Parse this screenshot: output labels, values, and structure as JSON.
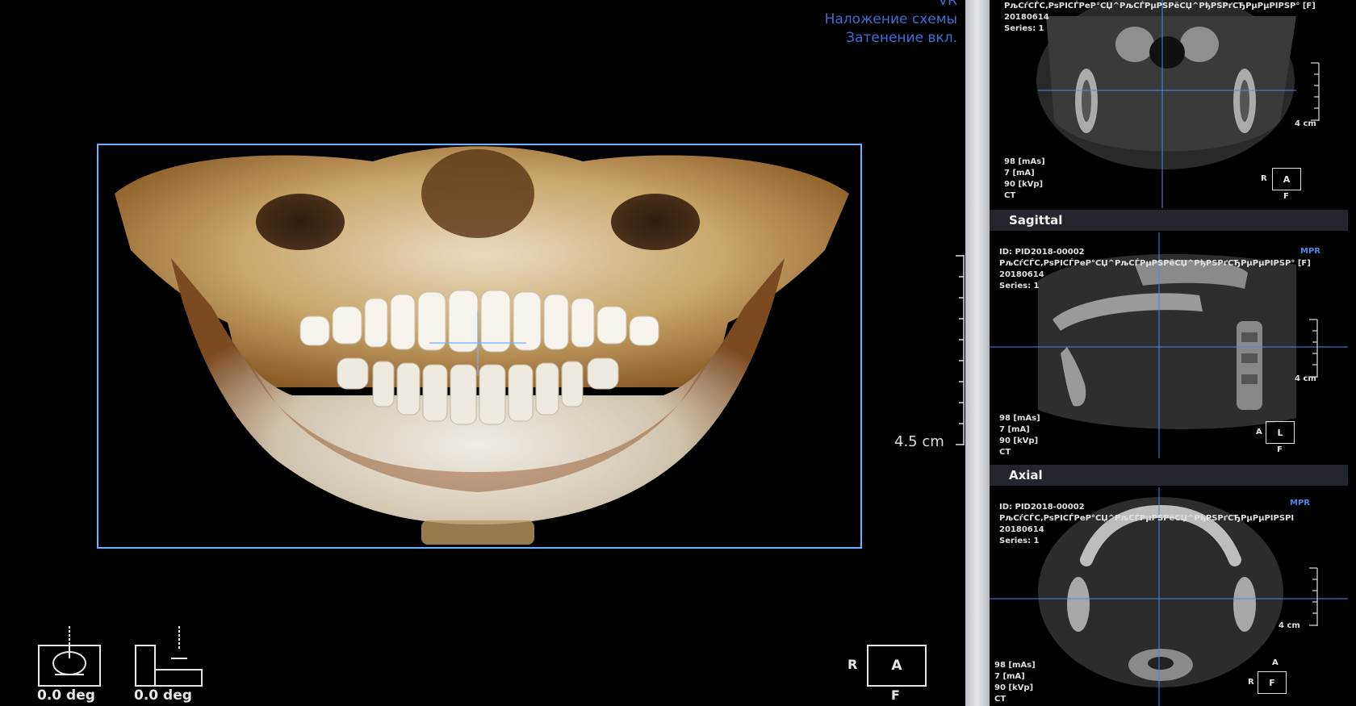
{
  "main_view": {
    "overlay_lines": [
      "VR",
      "Наложение схемы",
      "Затенение вкл."
    ],
    "scale_label": "4.5 cm",
    "rotation_left": "0.0 deg",
    "rotation_right": "0.0 deg",
    "orientation": {
      "center": "A",
      "left": "R",
      "bottom": "F"
    }
  },
  "mpr": {
    "coronal": {
      "patient_line": "PљCѓCЃC‚PsPICЃPeP°CЏ^PљCЃPµPSPёCЏ^PђPSPґCЂPµPµPIPSP° [F]",
      "date": "20180614",
      "series": "Series: 1",
      "scale_label": "4 cm",
      "params": [
        "98 [mAs]",
        "7 [mA]",
        "90 [kVp]",
        "CT"
      ],
      "orientation": {
        "center": "A",
        "left": "R",
        "bottom": "F"
      }
    },
    "sagittal": {
      "header": "Sagittal",
      "id": "ID: PID2018-00002",
      "tag": "MPR",
      "patient_line": "PљCѓCЃC‚PsPICЃPeP°CЏ^PљCЃPµPSPёCЏ^PђPSPґCЂPµPµPIPSP° [F]",
      "date": "20180614",
      "series": "Series: 1",
      "scale_label": "4 cm",
      "params": [
        "98 [mAs]",
        "7 [mA]",
        "90 [kVp]",
        "CT"
      ],
      "orientation": {
        "center": "L",
        "left": "A",
        "bottom": "F"
      }
    },
    "axial": {
      "header": "Axial",
      "id": "ID: PID2018-00002",
      "tag": "MPR",
      "patient_line": "PљCѓCЃC‚PsPICЃPeP°CЏ^PљCЃPµPSPёCЏ^PђPSPґCЂPµPµPIPSPI",
      "date": "20180614",
      "series": "Series: 1",
      "scale_label": "4 cm",
      "params": [
        "98 [mAs]",
        "7 [mA]",
        "90 [kVp]",
        "CT"
      ],
      "orientation": {
        "center": "F",
        "left": "R",
        "top": "A"
      }
    }
  }
}
